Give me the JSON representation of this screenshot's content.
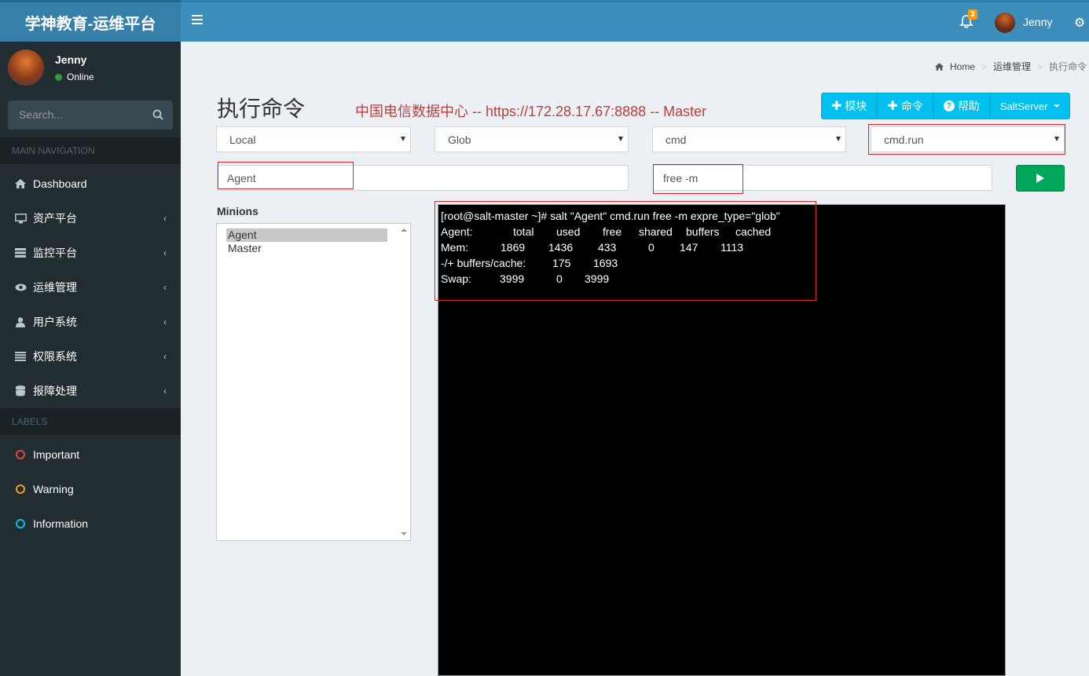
{
  "header": {
    "brand": "学神教育-运维平台",
    "notification_count": "3",
    "user_name": "Jenny"
  },
  "sidebar": {
    "user_name": "Jenny",
    "status": "Online",
    "search_placeholder": "Search...",
    "main_nav_header": "MAIN NAVIGATION",
    "items": [
      {
        "label": "Dashboard",
        "icon": "home-icon"
      },
      {
        "label": "资产平台",
        "icon": "desktop-icon"
      },
      {
        "label": "监控平台",
        "icon": "server-icon"
      },
      {
        "label": "运维管理",
        "icon": "eye-icon"
      },
      {
        "label": "用户系统",
        "icon": "user-icon"
      },
      {
        "label": "权限系统",
        "icon": "list-icon"
      },
      {
        "label": "报障处理",
        "icon": "database-icon"
      }
    ],
    "labels_header": "LABELS",
    "labels": [
      {
        "label": "Important",
        "color": "#dd4b39"
      },
      {
        "label": "Warning",
        "color": "#f39c12"
      },
      {
        "label": "Information",
        "color": "#00c0ef"
      }
    ]
  },
  "breadcrumb": {
    "home": "Home",
    "section": "运维管理",
    "current": "执行命令"
  },
  "page": {
    "title": "执行命令",
    "subtitle": "中国电信数据中心 -- https://172.28.17.67:8888 -- Master"
  },
  "toolbar": {
    "module_label": "模块",
    "command_label": "命令",
    "help_label": "帮助",
    "server_label": "SaltServer"
  },
  "selects": {
    "client": "Local",
    "target_type": "Glob",
    "module": "cmd",
    "function": "cmd.run"
  },
  "inputs": {
    "target": "Agent",
    "arguments": "free -m"
  },
  "minions": {
    "label": "Minions",
    "items": [
      "Agent",
      "Master"
    ],
    "selected": "Agent"
  },
  "terminal": {
    "command": "[root@salt-master ~]# salt \"Agent\" cmd.run free -m expre_type=\"glob\"",
    "header": [
      "Agent:",
      "total",
      "used",
      "free",
      "shared",
      "buffers",
      "cached"
    ],
    "mem": [
      "Mem:",
      "1869",
      "1436",
      "433",
      "0",
      "147",
      "1113"
    ],
    "buffers": [
      "-/+ buffers/cache:",
      "175",
      "1693"
    ],
    "swap": [
      "Swap:",
      "3999",
      "0",
      "3999"
    ]
  }
}
